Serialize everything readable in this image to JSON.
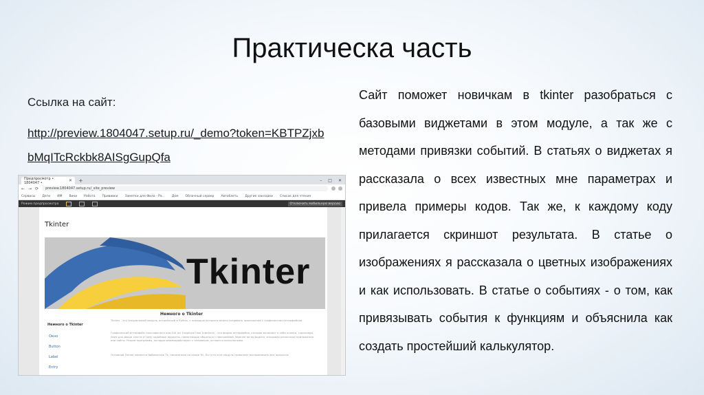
{
  "slide": {
    "title": "Практическа часть",
    "link_label": "Ссылка на сайт:",
    "link_url": "http://preview.1804047.setup.ru/_demo?token=KBTPZjxbbMqITcRckbk8AISgGupQfa",
    "body": "Сайт поможет новичкам в tkinter разобраться с базовыми виджетами в этом модуле, а так же с методами привязки событий. В статьях о виджетах я рассказала о всех известных мне параметрах и привела примеры кодов. Так же, к каждому коду прилагается скриншот результата. В статье о изображениях я рассказала о цветных изображениях и как использовать. В статье о событиях - о том, как привязывать события к функциям и объяснила как создать простейший калькулятор."
  },
  "screenshot": {
    "tab_title": "Предпросмотр • 1804047 •",
    "url": "preview.1804047.setup.ru/_site_preview",
    "bookmarks": [
      "Сервисы",
      "Дети",
      "ИМ",
      "Вики",
      "Работа",
      "Прививки",
      "Заметки для Фила - Ра...",
      "Дом",
      "Облачный сервер",
      "Автоблеть",
      "Другие закладки",
      "Список для чтения"
    ],
    "devbar_label": "Режим предпросмотра",
    "devbar_button": "Отключить мобильную версию",
    "page_heading": "Tkinter",
    "banner_text": "Tkinter",
    "sidebar_title": "Немного о Tkinter",
    "sidebar_links": [
      "Окно",
      "Button",
      "Label",
      "Entry"
    ],
    "section_title": "Немного о Tkinter",
    "paragraphs": [
      "Tkinter - это специальный модуль, встроенный в Python, с помощью которого можно создавать приложения с графическим интерфейсом.",
      "Графический интерфейс пользователя или GUI (от Graphical User Interface) - это форма интерфейса, которая включает в себя кнопки, скроллеры, поле для ввода текста и тому подобные виджеты, помогающие общаться с программой. Именно во вы видите, открывая различные приложения или сайты. Режим программы, которые взаимодействуют с человеком, остаются консольными.",
      "Основной Tkinter является библиотека Tk, написанная на языке Tcl. По сути этот модуль позволяет воспринимать все процессы"
    ]
  }
}
